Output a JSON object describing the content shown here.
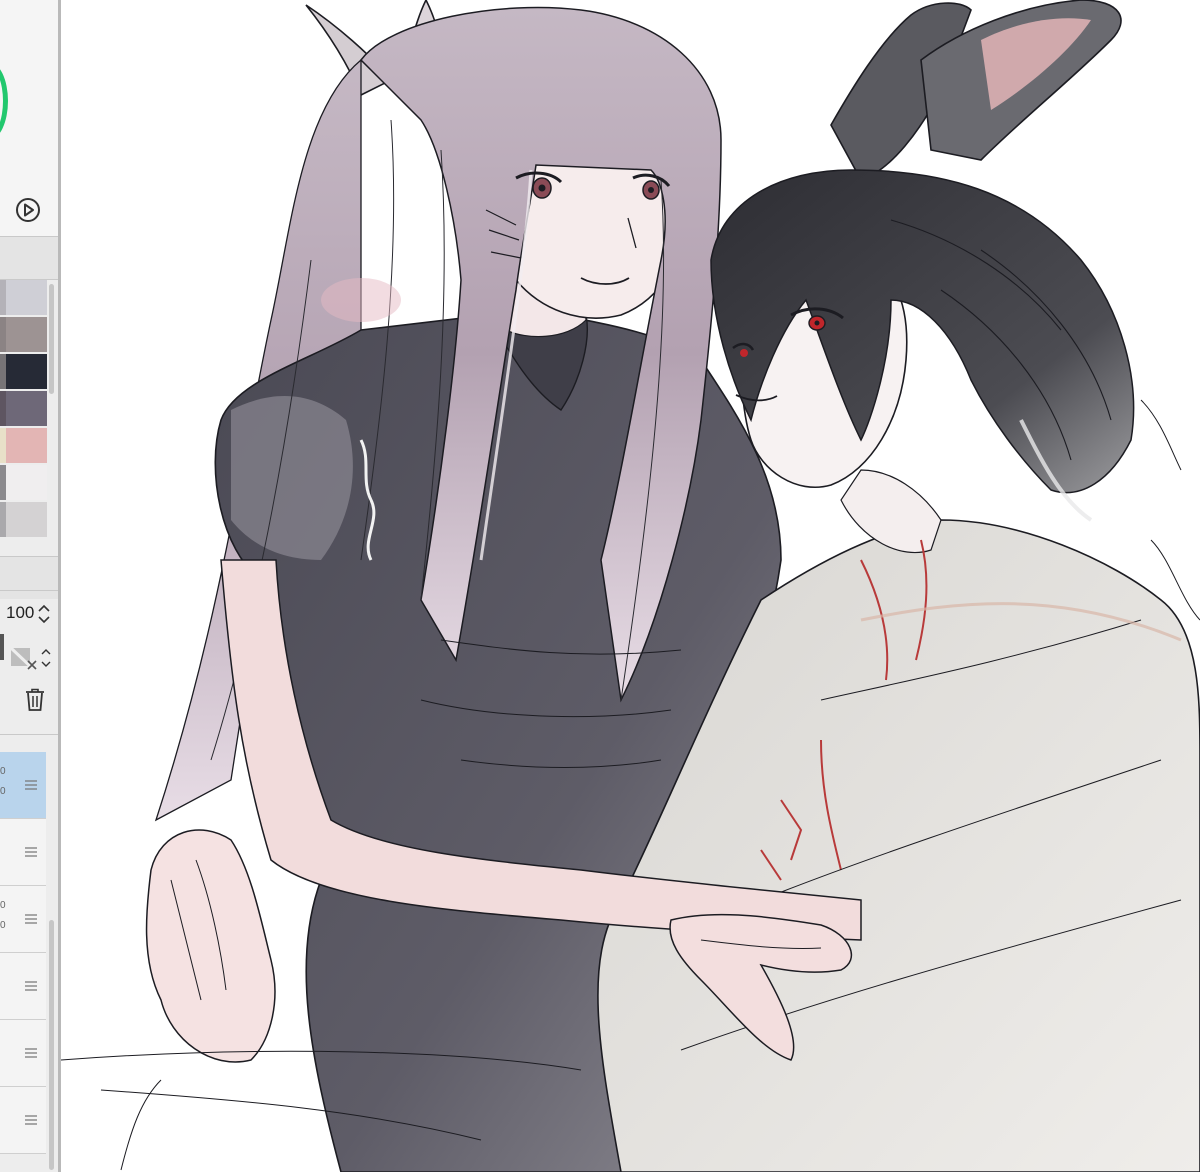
{
  "app": {
    "panel": {
      "opacity_value": "100",
      "icons": [
        "color-wheel-icon",
        "play-icon",
        "chevron-up-down-icon",
        "blend-mode-icon",
        "trash-icon",
        "drag-handle-icon"
      ]
    },
    "swatches": [
      {
        "color": "#b4b2b8"
      },
      {
        "color": "#cfcfd6"
      },
      {
        "color": "#8b8384"
      },
      {
        "color": "#9d9393"
      },
      {
        "color": "#777477"
      },
      {
        "color": "#262a36"
      },
      {
        "color": "#5e5561"
      },
      {
        "color": "#6e6878"
      },
      {
        "color": "#e8e0c8"
      },
      {
        "color": "#e3b5b4"
      },
      {
        "color": "#8c8a8e"
      },
      {
        "color": "#f0eeef"
      },
      {
        "color": "#aaa9ac"
      },
      {
        "color": "#d4d2d3"
      }
    ],
    "layers": [
      {
        "selected": true,
        "meta_top": "0",
        "meta_bottom": "0"
      },
      {
        "selected": false,
        "meta_top": "",
        "meta_bottom": ""
      },
      {
        "selected": false,
        "meta_top": "0",
        "meta_bottom": "0"
      },
      {
        "selected": false,
        "meta_top": "",
        "meta_bottom": ""
      },
      {
        "selected": false,
        "meta_top": "",
        "meta_bottom": ""
      },
      {
        "selected": false,
        "meta_top": "",
        "meta_bottom": ""
      }
    ]
  },
  "canvas": {
    "artwork": "sketch-illustration",
    "palette": {
      "line": "#1c1c22",
      "hair_light": "#b9a8b4",
      "hair_dark": "#3a3a40",
      "dress": "#55535e",
      "skin": "#f3e3e2",
      "blush": "#e6b9b8",
      "shirt": "#e3e0db",
      "accent_red": "#b83a3a"
    }
  }
}
